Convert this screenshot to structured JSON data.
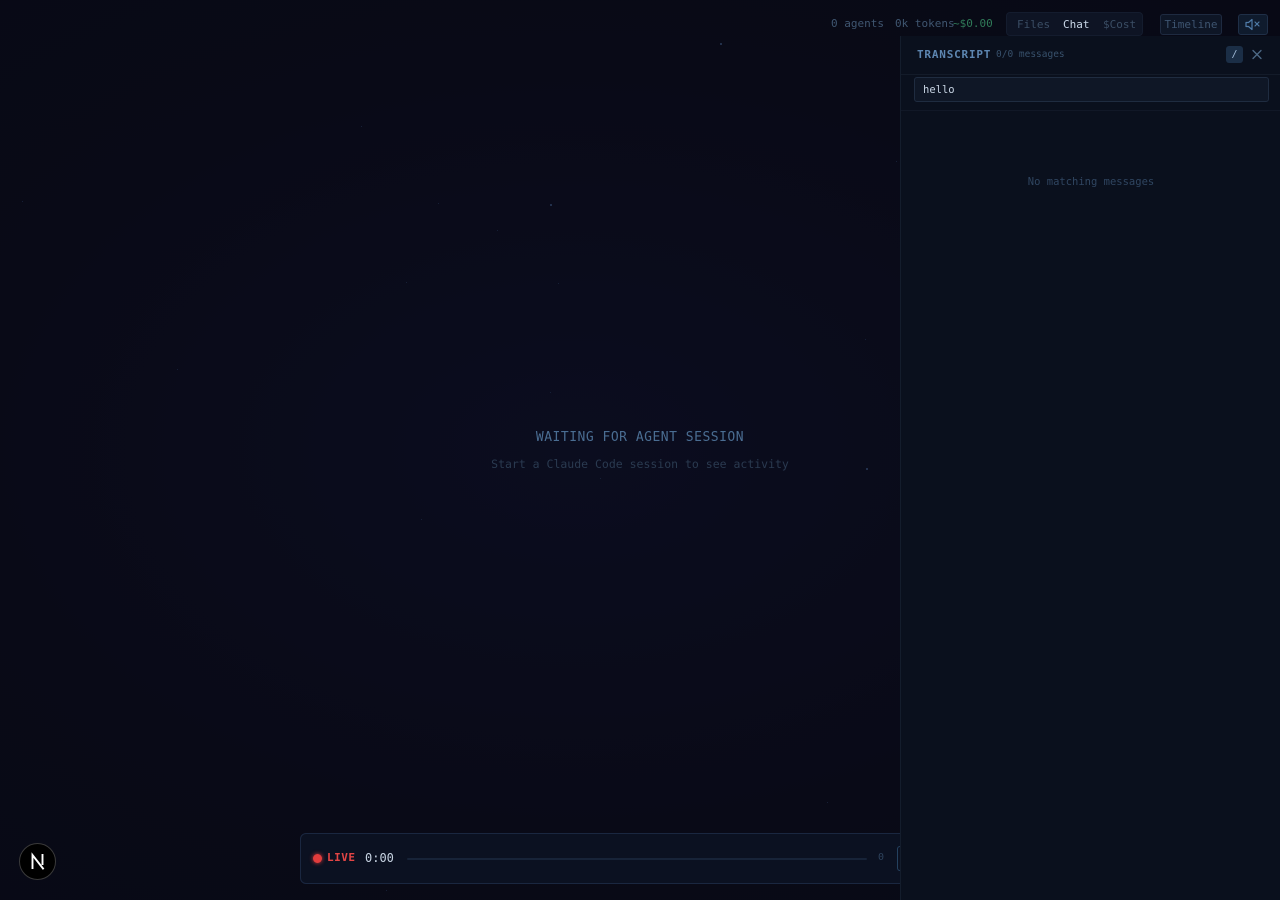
{
  "header": {
    "agents": "0 agents",
    "tokens": "0k tokens",
    "cost": "~$0.00",
    "views": [
      {
        "label": "Files",
        "active": false
      },
      {
        "label": "Chat",
        "active": true
      },
      {
        "label": "$Cost",
        "active": false
      }
    ],
    "timeline_label": "Timeline",
    "mute_icon": "speaker-muted-icon"
  },
  "center": {
    "title": "WAITING FOR AGENT SESSION",
    "subtitle": "Start a Claude Code session to see activity"
  },
  "transcript": {
    "title": "TRANSCRIPT",
    "count": "0/0 messages",
    "shortcut_label": "/",
    "search_value": "hello",
    "empty_message": "No matching messages"
  },
  "playback": {
    "live_label": "LIVE",
    "time": "0:00",
    "event_count": "0",
    "progress": 0
  },
  "logo": {
    "letter": "N"
  },
  "colors": {
    "accent": "#5d86b1",
    "live": "#e23c3c",
    "cost": "#2f7a58",
    "background": "#090a17"
  }
}
